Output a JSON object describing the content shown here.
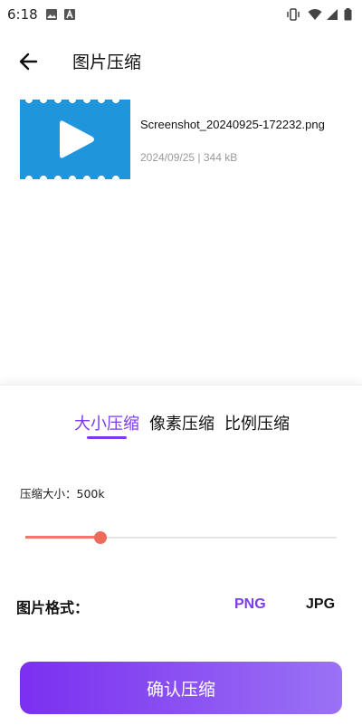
{
  "status_bar": {
    "time": "6:18",
    "left_icons": [
      "image-icon",
      "text-a-icon"
    ],
    "right_icons": [
      "vibrate-icon",
      "wifi-icon",
      "signal-icon",
      "battery-icon"
    ]
  },
  "app_bar": {
    "back_icon": "arrow-left-icon",
    "title": "图片压缩"
  },
  "file": {
    "thumbnail_icon": "video-play-icon",
    "thumbnail_color": "#1f95db",
    "name": "Screenshot_20240925-172232.png",
    "meta": "2024/09/25 | 344 kB"
  },
  "tabs": {
    "items": [
      {
        "label": "大小压缩",
        "active": true
      },
      {
        "label": "像素压缩",
        "active": false
      },
      {
        "label": "比例压缩",
        "active": false
      }
    ]
  },
  "size": {
    "label": "压缩大小：500k",
    "slider_fraction": 0.24,
    "slider_color": "#ee6b5b"
  },
  "format": {
    "label": "图片格式：",
    "options": [
      {
        "label": "PNG",
        "selected": true
      },
      {
        "label": "JPG",
        "selected": false
      }
    ]
  },
  "confirm_button": {
    "label": "确认压缩"
  },
  "colors": {
    "accent": "#7c3aed",
    "button_gradient_start": "#7b2ff0",
    "button_gradient_end": "#9a72f5"
  }
}
